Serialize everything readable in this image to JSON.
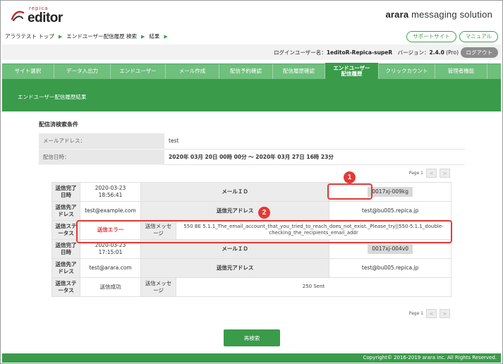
{
  "logo": {
    "small": "repica",
    "big": "editor"
  },
  "brand": {
    "prefix": "arara",
    "suffix": " messaging solution"
  },
  "breadcrumb": [
    "アララテスト トップ",
    "エンドユーザー配信履歴 検索",
    "結果"
  ],
  "top_buttons": {
    "support": "サポートサイト",
    "manual": "マニュアル"
  },
  "userbar": {
    "login_label": "ログインユーザー名：",
    "login_user": "1editoR-Repica-supeR",
    "version_label": "　バージョン：",
    "version": "2.4.0",
    "version_suffix": " (Pro)",
    "logout": "ログアウト"
  },
  "nav": [
    {
      "label": "サイト選択",
      "w": 74
    },
    {
      "label": "データ入出力",
      "w": 80
    },
    {
      "label": "エンドユーザー",
      "w": 78
    },
    {
      "label": "メール作成",
      "w": 76
    },
    {
      "label": "配信予約確認",
      "w": 76
    },
    {
      "label": "配信履歴確認",
      "w": 74
    },
    {
      "label": "エンドユーザー配信履歴",
      "w": 76,
      "active": true
    },
    {
      "label": "クリックカウント",
      "w": 80
    },
    {
      "label": "管理者機能",
      "w": 74
    }
  ],
  "banner": "エンドユーザー配信履歴結果",
  "condition": {
    "title": "配信済検索条件",
    "email_label": "メールアドレス：",
    "email_value": "test",
    "date_label": "配信日時：",
    "date_value": "2020年 03月 20日 00時 00分 ～ 2020年 03月 27日 16時 23分"
  },
  "pager": {
    "label": "Page 1",
    "prev": "<",
    "next": ">"
  },
  "labels": {
    "completed": "送信完了日時",
    "recipient": "送信先アドレス",
    "status": "送信ステータス",
    "mail_id": "メールＩＤ",
    "sender": "送信元アドレス",
    "message": "送信メッセージ"
  },
  "results": [
    {
      "completed": "2020-03-23 18:56:41",
      "mail_id": "0017xj-009kg",
      "recipient": "test@example.com",
      "sender": "test@bu005.repica.jp",
      "status": "送信エラー",
      "status_error": true,
      "message": "550 BE 5.1.1_The_email_account_that_you_tried_to_reach_does_not_exist._Please_try||550-5.1.1_double-checking_the_recipients_email_addr"
    },
    {
      "completed": "2020-03-23 17:15:01",
      "mail_id": "0017xj-004v0",
      "recipient": "test@arara.com",
      "sender": "test@bu005.repica.jp",
      "status": "送信成功",
      "status_error": false,
      "message": "250 Sent"
    }
  ],
  "badges": [
    "1",
    "2"
  ],
  "research_button": "再検索",
  "footer": "Copyright© 2016-2019 arara inc. All Rights Reserved.",
  "colors": {
    "primary": "#3a9b4b",
    "nav": "#6fbf7d",
    "highlight": "#e53935",
    "error": "#e53030"
  }
}
